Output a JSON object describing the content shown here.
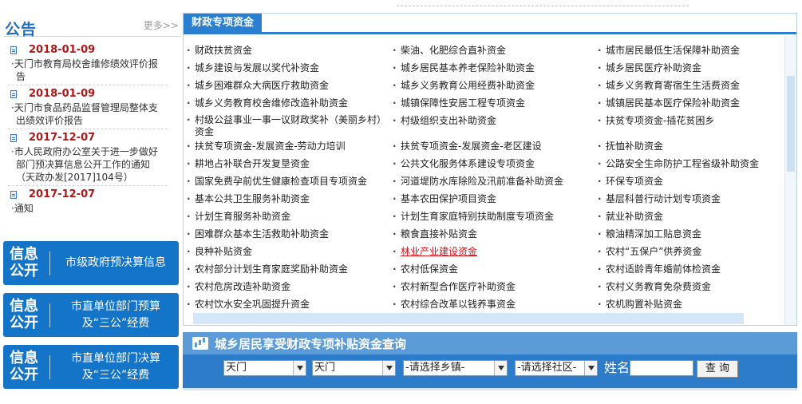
{
  "notice": {
    "title": "公告",
    "more": "更多>>",
    "items": [
      {
        "date": "2018-01-09",
        "lines": [
          "·天门市教育局校舍维修绩效评价报",
          "告"
        ]
      },
      {
        "date": "2018-01-09",
        "lines": [
          "·天门市食品药品监督管理局整体支",
          "出绩效评价报告"
        ]
      },
      {
        "date": "2017-12-07",
        "lines": [
          "·市人民政府办公室关于进一步做好",
          "部门预决算信息公开工作的通知",
          "（天政办发[2017]104号）"
        ]
      },
      {
        "date": "2017-12-07",
        "lines": [
          "·通知"
        ]
      }
    ]
  },
  "banners": [
    {
      "left": "信息\n公开",
      "right": "市级政府预决算信息"
    },
    {
      "left": "信息\n公开",
      "right": "市直单位部门预算\n及“三公”经费"
    },
    {
      "left": "信息\n公开",
      "right": "市直单位部门决算\n及“三公”经费"
    }
  ],
  "panel": {
    "tab": "财政专项资金",
    "rows": [
      [
        "财政扶贫资金",
        "柴油、化肥综合直补资金",
        "城市居民最低生活保障补助资金"
      ],
      [
        "城乡建设与发展以奖代补资金",
        "城乡居民基本养老保险补助资金",
        "城乡居民医疗补助资金"
      ],
      [
        "城乡困难群众大病医疗救助资金",
        "城乡义务教育公用经费补助资金",
        "城乡义务教育寄宿生生活费资金"
      ],
      [
        "城乡义务教育校舍维修改造补助资金",
        "城镇保障性安居工程专项资金",
        "城镇居民基本医疗保险补助资金"
      ],
      [
        "村级公益事业一事一议财政奖补（美丽乡村）资金",
        "村级组织支出补助资金",
        "扶贫专项资金-插花贫困乡"
      ],
      [
        "扶贫专项资金-发展资金-劳动力培训",
        "扶贫专项资金-发展资金-老区建设",
        "抚恤补助资金"
      ],
      [
        "耕地占补联合开发复垦资金",
        "公共文化服务体系建设专项资金",
        "公路安全生命防护工程省级补助资金"
      ],
      [
        "国家免费孕前优生健康检查项目专项资金",
        "河道堤防水库除险及汛前准备补助资金",
        "环保专项资金"
      ],
      [
        "基本公共卫生服务补助资金",
        "基本农田保护项目资金",
        "基层科普行动计划专项资金"
      ],
      [
        "计划生育服务补助资金",
        "计划生育家庭特别扶助制度专项资金",
        "就业补助资金"
      ],
      [
        "困难群众基本生活救助补助资金",
        "粮食直接补贴资金",
        "粮油精深加工贴息资金"
      ],
      [
        "良种补贴资金",
        "林业产业建设资金",
        "农村“五保户”供养资金"
      ],
      [
        "农村部分计划生育家庭奖励补助资金",
        "农村低保资金",
        "农村适龄青年婚前体检资金"
      ],
      [
        "农村危房改造补助资金",
        "农村新型合作医疗补助资金",
        "农村义务教育免杂费资金"
      ],
      [
        "农村饮水安全巩固提升资金",
        "农村综合改革以钱养事资金",
        "农机购置补贴资金"
      ]
    ],
    "highlight_link": "林业产业建设资金",
    "link_color": "#d4141a"
  },
  "query": {
    "title": "城乡居民享受财政专项补贴资金查询",
    "select1": "天门",
    "select2": "天门",
    "select3": "-请选择乡镇-",
    "select4": "-请选择社区-",
    "name_label": "姓名",
    "button": "查 询"
  },
  "colors": {
    "brand_blue": "#1474c8",
    "tab_blue": "#2a7fd0",
    "date_red": "#b01818"
  }
}
